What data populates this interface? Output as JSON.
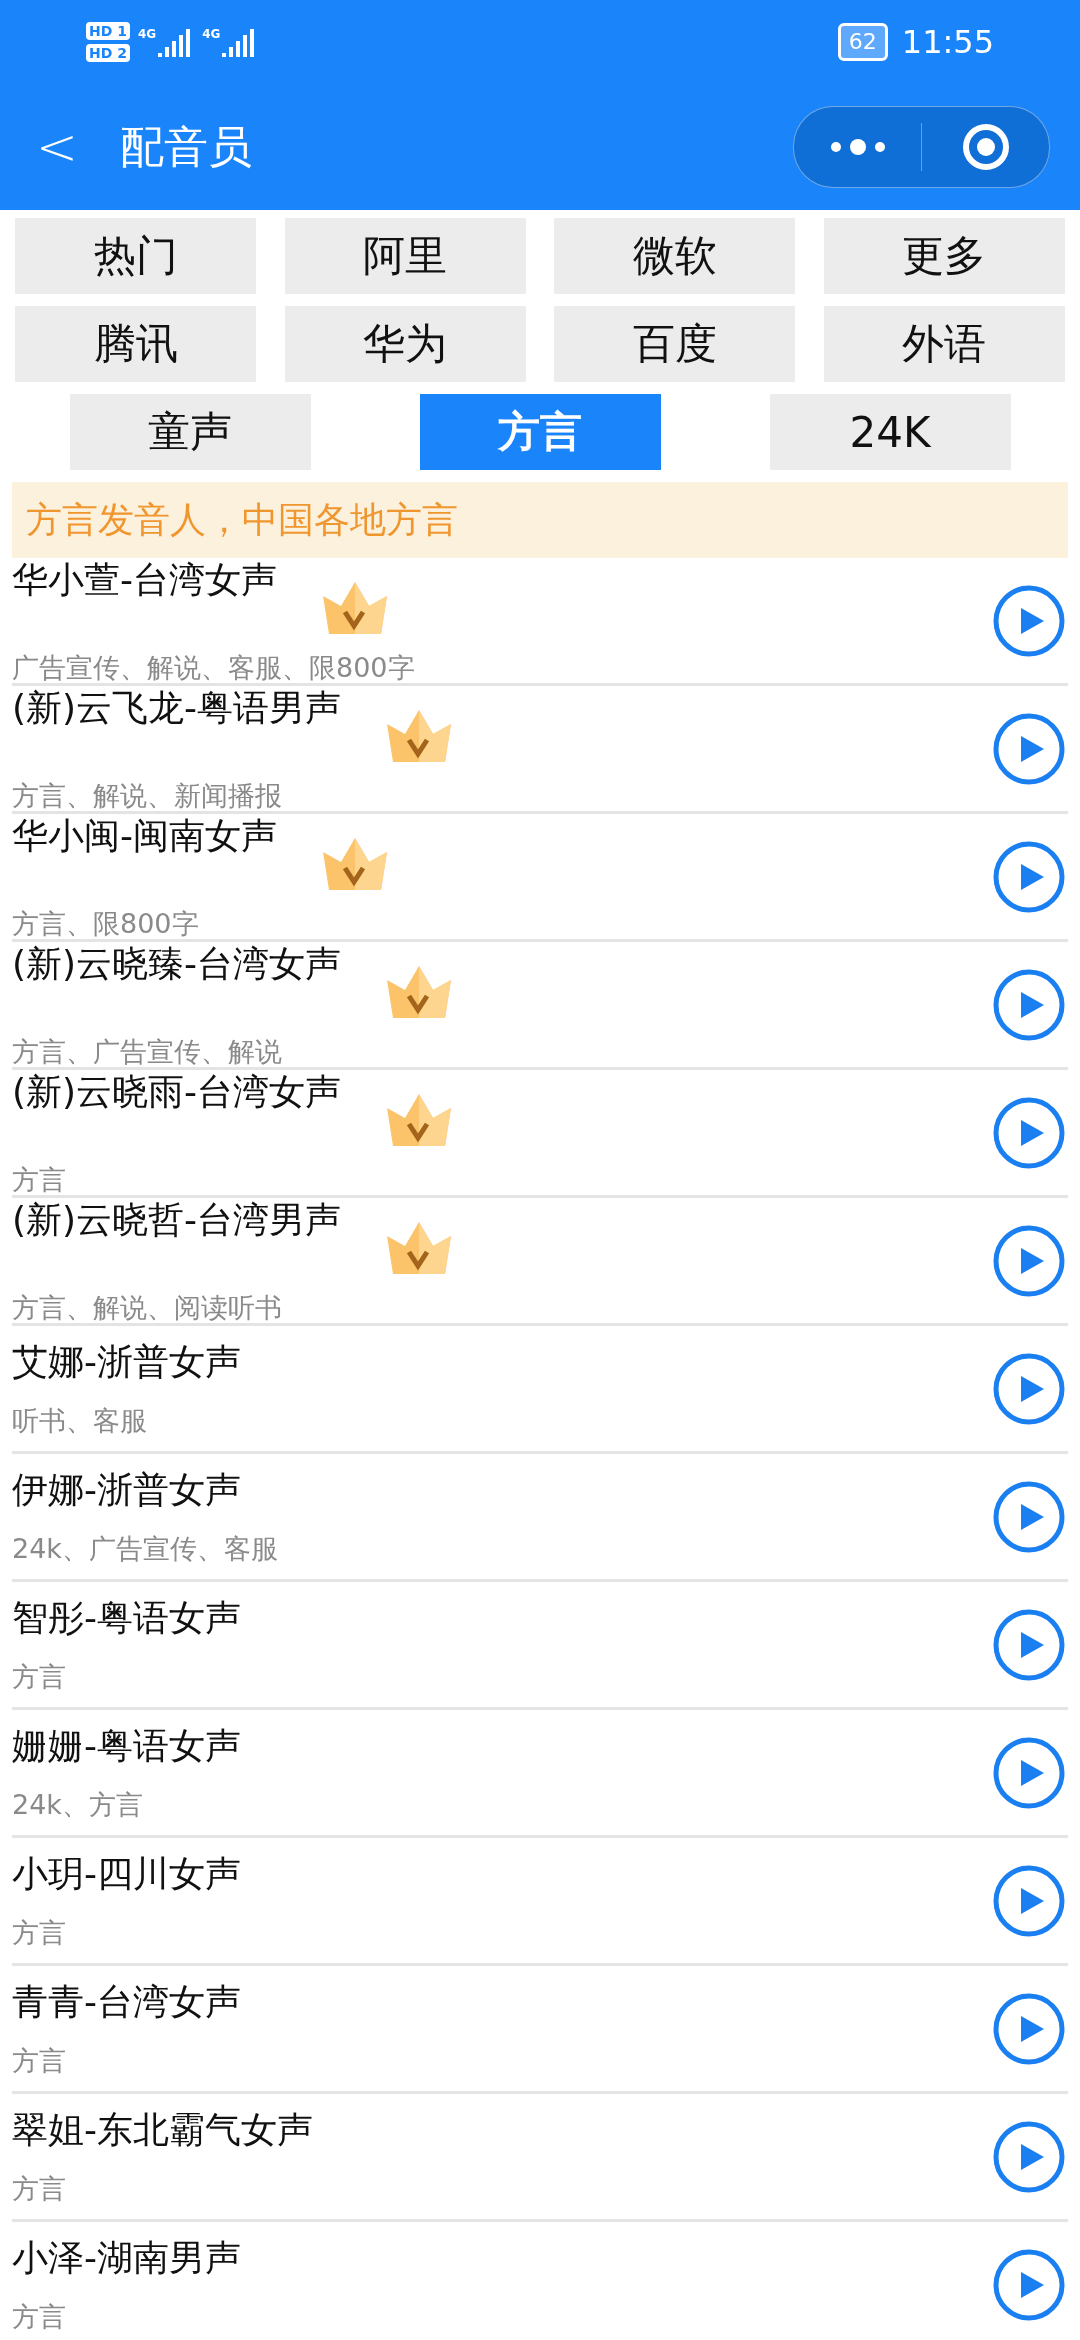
{
  "status_bar": {
    "sims": [
      {
        "label": "HD",
        "slot": "1"
      },
      {
        "label": "HD",
        "slot": "2"
      }
    ],
    "networks": [
      "4G",
      "4G"
    ],
    "battery": "62",
    "time": "11:55"
  },
  "header": {
    "back": "<",
    "title": "配音员"
  },
  "tabs": [
    [
      {
        "label": "热门",
        "selected": false
      },
      {
        "label": "阿里",
        "selected": false
      },
      {
        "label": "微软",
        "selected": false
      },
      {
        "label": "更多",
        "selected": false
      }
    ],
    [
      {
        "label": "腾讯",
        "selected": false
      },
      {
        "label": "华为",
        "selected": false
      },
      {
        "label": "百度",
        "selected": false
      },
      {
        "label": "外语",
        "selected": false
      }
    ],
    [
      {
        "label": "童声",
        "selected": false
      },
      {
        "label": "方言",
        "selected": true
      },
      {
        "label": "24K",
        "selected": false
      }
    ]
  ],
  "banner": "方言发音人，中国各地方言",
  "voices": [
    {
      "name": "华小萱-台湾女声",
      "tags": "广告宣传、解说、客服、限800字",
      "vip": true
    },
    {
      "name": "(新)云飞龙-粤语男声",
      "tags": "方言、解说、新闻播报",
      "vip": true
    },
    {
      "name": "华小闽-闽南女声",
      "tags": "方言、限800字",
      "vip": true
    },
    {
      "name": "(新)云晓臻-台湾女声",
      "tags": "方言、广告宣传、解说",
      "vip": true
    },
    {
      "name": "(新)云晓雨-台湾女声",
      "tags": "方言",
      "vip": true
    },
    {
      "name": "(新)云晓哲-台湾男声",
      "tags": "方言、解说、阅读听书",
      "vip": true
    },
    {
      "name": "艾娜-浙普女声",
      "tags": "听书、客服",
      "vip": false
    },
    {
      "name": "伊娜-浙普女声",
      "tags": "24k、广告宣传、客服",
      "vip": false
    },
    {
      "name": "智彤-粤语女声",
      "tags": "方言",
      "vip": false
    },
    {
      "name": "姗姗-粤语女声",
      "tags": "24k、方言",
      "vip": false
    },
    {
      "name": "小玥-四川女声",
      "tags": "方言",
      "vip": false
    },
    {
      "name": "青青-台湾女声",
      "tags": "方言",
      "vip": false
    },
    {
      "name": "翠姐-东北霸气女声",
      "tags": "方言",
      "vip": false
    },
    {
      "name": "小泽-湖南男声",
      "tags": "方言",
      "vip": false
    }
  ]
}
